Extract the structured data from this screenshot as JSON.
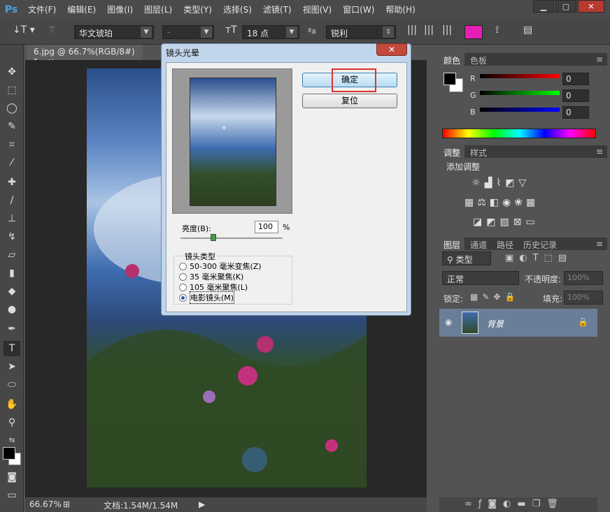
{
  "app": {
    "logo": "Ps"
  },
  "menu": [
    "文件(F)",
    "编辑(E)",
    "图像(I)",
    "图层(L)",
    "类型(Y)",
    "选择(S)",
    "滤镜(T)",
    "视图(V)",
    "窗口(W)",
    "帮助(H)"
  ],
  "options": {
    "font_family": "华文琥珀",
    "font_style": "-",
    "font_size": "18 点",
    "aa_label": "ªa",
    "antialias": "锐利",
    "color": "#e61fb4"
  },
  "document": {
    "tab_title": "6.jpg @ 66.7%(RGB/8#) *",
    "zoom": "66.67%",
    "doc_size": "文档:1.54M/1.54M"
  },
  "dialog": {
    "title": "镜头光晕",
    "ok": "确定",
    "reset": "复位",
    "brightness_label": "亮度(B):",
    "brightness_value": "100",
    "brightness_unit": "%",
    "lens_group": "镜头类型",
    "lens_options": [
      "50-300 毫米变焦(Z)",
      "35 毫米聚焦(K)",
      "105 毫米聚焦(L)",
      "电影镜头(M)"
    ],
    "selected_lens": 3
  },
  "color_panel": {
    "tabs": [
      "颜色",
      "色板"
    ],
    "r_label": "R",
    "g_label": "G",
    "b_label": "B",
    "r": "0",
    "g": "0",
    "b": "0"
  },
  "adjust_panel": {
    "tabs": [
      "调整",
      "样式"
    ],
    "title": "添加调整"
  },
  "layers_panel": {
    "tabs": [
      "图层",
      "通道",
      "路径",
      "历史记录"
    ],
    "kind": "类型",
    "blend_mode": "正常",
    "opacity_label": "不透明度:",
    "opacity": "100%",
    "lock_label": "锁定:",
    "fill_label": "填充:",
    "fill": "100%",
    "layer_name": "背景"
  },
  "footer_icons": [
    "link-icon",
    "fx-icon",
    "mask-icon",
    "adjustment-icon",
    "folder-icon",
    "new-layer-icon",
    "trash-icon"
  ]
}
